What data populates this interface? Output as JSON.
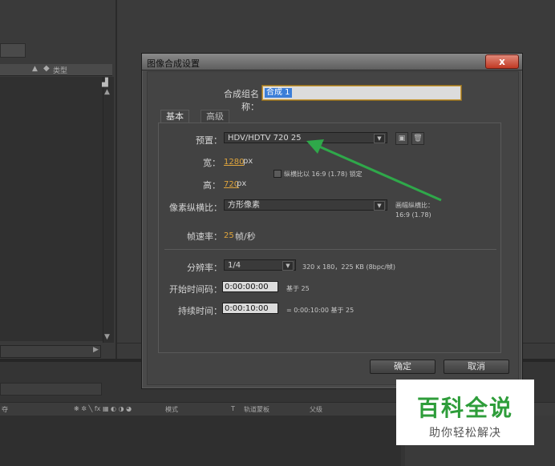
{
  "background": {
    "project_header_type": "类型",
    "timeline_cols": [
      "夺",
      "❋ ✲ ╲ fx ▦ ◐ ◑ ◕",
      "模式",
      "T",
      "轨道蒙板",
      "父级"
    ]
  },
  "dialog": {
    "title": "图像合成设置",
    "close_label": "x",
    "name_label": "合成组名称：",
    "name_value": "合成 1",
    "tabs": [
      "基本",
      "高级"
    ],
    "preset_label": "预置：",
    "preset_value": "HDV/HDTV 720 25",
    "width_label": "宽：",
    "width_value": "1280",
    "height_label": "高：",
    "height_value": "720",
    "px_unit": "px",
    "lock_label": "纵横比以 16:9 (1.78) 锁定",
    "pixel_aspect_label": "像素纵横比：",
    "pixel_aspect_value": "方形像素",
    "frame_aspect_label": "画幅纵横比：",
    "frame_aspect_value": "16:9 (1.78)",
    "fps_label": "帧速率：",
    "fps_value": "25",
    "fps_unit": "帧/秒",
    "resolution_label": "分辨率：",
    "resolution_value": "1/4",
    "resolution_info": "320 x 180，225 KB (8bpc/帧)",
    "start_label": "开始时间码：",
    "start_value": "0:00:00:00",
    "start_note": "基于 25",
    "duration_label": "持续时间：",
    "duration_value": "0:00:10:00",
    "duration_note": "= 0:00:10:00  基于 25",
    "ok_label": "确定",
    "cancel_label": "取消"
  },
  "watermark": {
    "main": "百科全说",
    "sub": "助你轻松解决"
  },
  "colors": {
    "accent_orange": "#e0a53c",
    "arrow_green": "#2fa84a",
    "close_red": "#c23a24"
  }
}
